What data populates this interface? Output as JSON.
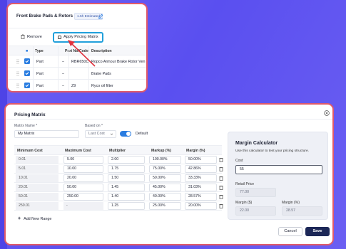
{
  "colors": {
    "accent": "#2a7de1",
    "highlight": "#21a0db",
    "annotation": "#e0333f",
    "save_bg": "#1c2757",
    "background": "#5a4ff0"
  },
  "top_card": {
    "title": "Front Brake Pads & Rotors",
    "badge": "1.5h Estimated",
    "remove_label": "Remove",
    "apply_label": "Apply Pricing Matrix",
    "columns": [
      "Type",
      "Part No/Code",
      "Description"
    ],
    "rows": [
      {
        "type": "Part",
        "dash": "–",
        "code": "RBR650C",
        "description": "Ropco Armour Brake Rotor Ven"
      },
      {
        "type": "Part",
        "dash": "–",
        "code": "",
        "description": "Brake Pads"
      },
      {
        "type": "Part",
        "dash": "–",
        "code": "Z9",
        "description": "Ryco oil filter"
      }
    ]
  },
  "modal": {
    "title": "Pricing Matrix",
    "matrix_name_label": "Matrix Name *",
    "matrix_name_value": "My Matrix",
    "based_on_label": "Based on *",
    "based_on_value": "Last Cost",
    "default_label": "Default",
    "columns": [
      "Minimum Cost",
      "Maximum Cost",
      "Multiplier",
      "Markup (%)",
      "Margin (%)"
    ],
    "rows": [
      [
        "0.01",
        "5.00",
        "2.00",
        "100.00%",
        "50.00%"
      ],
      [
        "5.01",
        "10.00",
        "1.75",
        "75.00%",
        "42.86%"
      ],
      [
        "10.01",
        "20.00",
        "1.50",
        "50.00%",
        "33.33%"
      ],
      [
        "20.01",
        "50.00",
        "1.45",
        "45.00%",
        "31.03%"
      ],
      [
        "50.01",
        "250.00",
        "1.40",
        "40.00%",
        "28.57%"
      ],
      [
        "250.01",
        "-",
        "1.25",
        "25.00%",
        "20.00%"
      ]
    ],
    "add_range_label": "Add New Range",
    "calculator": {
      "title": "Margin Calculator",
      "description": "Use this calculator to test your pricing structure.",
      "cost_label": "Cost",
      "cost_value": "55",
      "retail_label": "Retail Price",
      "retail_value": "77.00",
      "margin_dollar_label": "Margin ($)",
      "margin_dollar_value": "22.00",
      "margin_pct_label": "Margin (%)",
      "margin_pct_value": "28.57"
    },
    "cancel_label": "Cancel",
    "save_label": "Save"
  }
}
